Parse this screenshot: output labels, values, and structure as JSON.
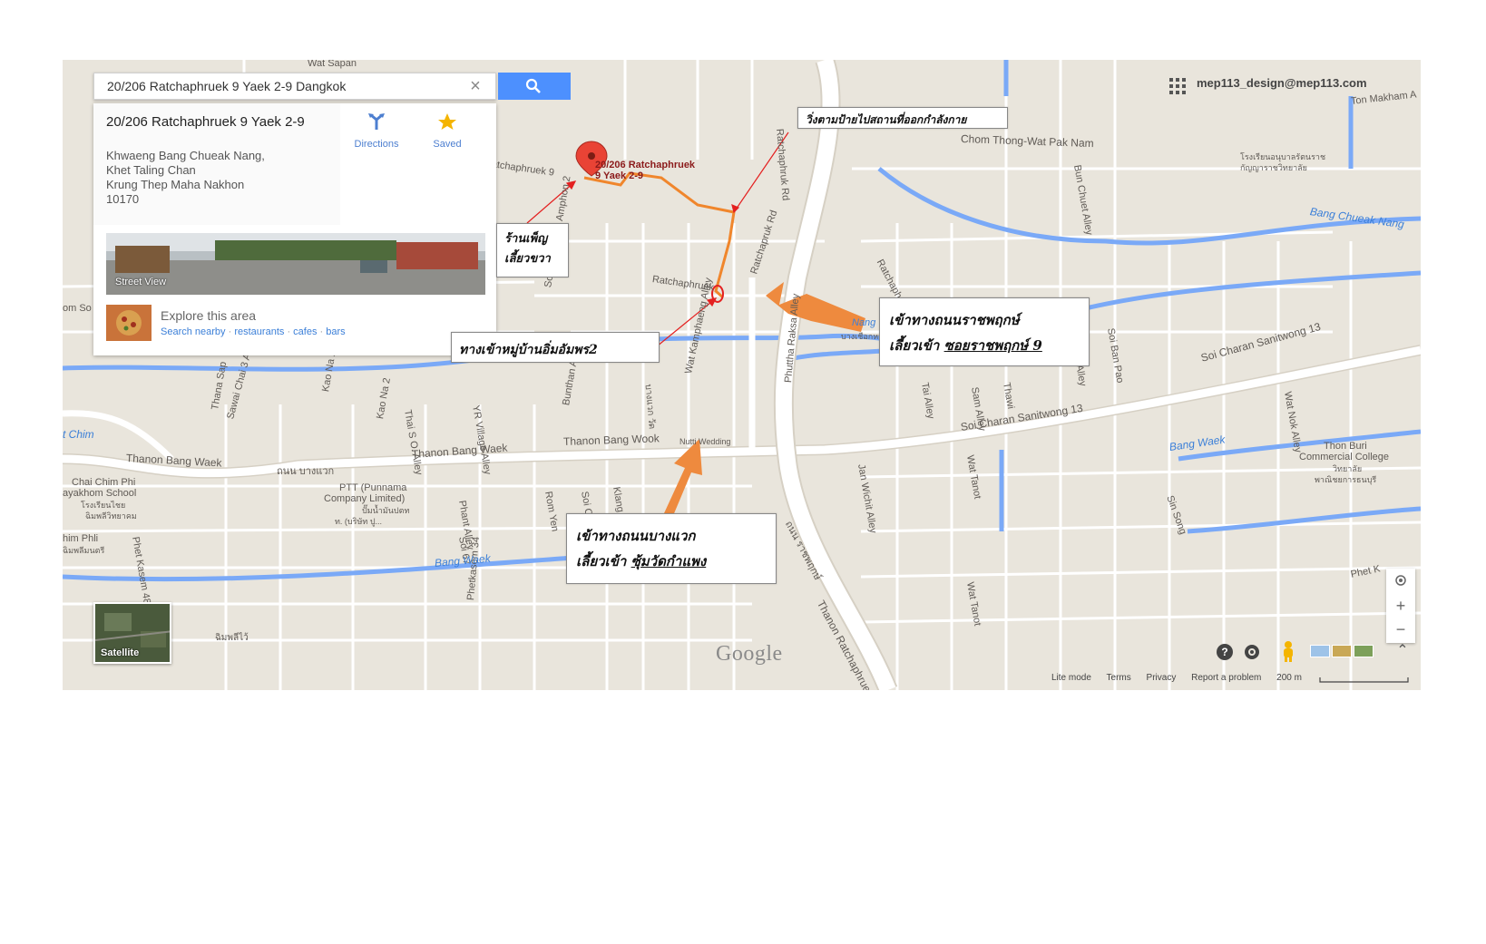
{
  "search": {
    "query": "20/206 Ratchaphruek 9 Yaek 2-9 Dangkok"
  },
  "place_card": {
    "title": "20/206 Ratchaphruek 9 Yaek 2-9",
    "address_lines": [
      "Khwaeng Bang Chueak Nang,",
      "Khet Taling Chan",
      "Krung Thep Maha Nakhon",
      "10170"
    ],
    "directions_label": "Directions",
    "saved_label": "Saved",
    "street_view_label": "Street View",
    "explore_title": "Explore this area",
    "explore_links": [
      "Search nearby",
      "restaurants",
      "cafes",
      "bars"
    ],
    "explore_sep": "·"
  },
  "account": {
    "email": "mep113_design@mep113.com"
  },
  "marker_label": [
    "20/206 Ratchaphruek",
    "9 Yaek 2-9"
  ],
  "callouts": {
    "top_right": "วิ่งตามป้ายไปสถานที่ออกกำลังกาย",
    "shop_line1": "ร้านเพ็ญ",
    "shop_line2": "เลี้ยวขวา",
    "village_entrance": "ทางเข้าหมู่บ้านอิ่มอัมพร2",
    "ratchaphruek_line1": "เข้าทางถนนราชพฤกษ์",
    "ratchaphruek_line2_prefix": "เลี้ยวเข้า",
    "ratchaphruek_line2_link": "ซอยราชพฤกษ์ 9",
    "bangwaek_line1": "เข้าทางถนนบางแวก",
    "bangwaek_line2_prefix": "เลี้ยวเข้า",
    "bangwaek_line2_link": "ซุ้มวัดกำแพง"
  },
  "map_labels": {
    "wat_sapan": "Wat Sapan",
    "ratchaphruek_9": "Ratchaphruek 9",
    "ratchaphruek_mid": "Ratchaphruek",
    "ratchaphruk_rd": "Ratchapruk Rd",
    "ratchaphruk_rd_top": "Ratchaphruk Rd",
    "chom_thong": "Chom Thong-Wat Pak Nam",
    "ton_makham": "Ton Makham A",
    "bang_chueak_nang": "Bang Chueak Nang",
    "bun_chuet": "Bun Chuet Alley",
    "rr_school": "โรงเรียนอนุบาลรัตนราช",
    "rr_school2": "กัญญาราชวิทยาลัย",
    "ratchaphruek_2yaek9": "Ratchaphruek 2 Yaek 9",
    "soi_charan_13_top": "Soi Charan Sanitwong 13",
    "soi_charan_13": "Soi Charan Sanitwong 13",
    "soi_mu_ban": "Soi Mu Ban Im Amphon 2",
    "nang": "Nang",
    "bang_sue_thai": "บางเชือกหนัง",
    "phuttha_raksa": "Phuttha Raksa Alley",
    "tai_alley": "Tai Alley",
    "sam_alley": "Sam Alley",
    "thawi": "Thawi",
    "ban_pao": "Soi Ban Pao",
    "wang_alley": "Wang Alley",
    "wat_nok": "Wat Nok Alley",
    "chim_left": "t Chim",
    "om_so": "om So",
    "thanon_bang_waek_left": "Thanon Bang Waek",
    "thai_bang_waek": "ถนน บางแวก",
    "thanon_bang_waek_mid": "Thanon Bang Waek",
    "thanon_bang_wook": "Thanon Bang Wook",
    "nutti_wedding": "Nutti Wedding",
    "bang_waek_right": "Bang Waek",
    "thon_buri_college": "Thon Buri",
    "thon_buri_college2": "Commercial College",
    "thon_buri_thai": "วิทยาลัย",
    "thon_buri_thai2": "พาณิชยการธนบุรี",
    "chai_chim": "Chai Chim Phi",
    "chai_chim2": "ayakhom School",
    "chai_chim_thai": "โรงเรียนไชย",
    "chai_chim_thai2": "ฉิมพลีวิทยาคม",
    "ptt": "PTT (Punnama",
    "ptt2": "Company Limited)",
    "ptt_thai": "ปั๊มน้ำมันปตท",
    "ptt_thai2": "ท. (บริษัท ปู...",
    "thana_sap": "Thana Sap",
    "sawai_chai": "Sawai Chai 3 Alley",
    "kao_na_2": "Kao Na 2",
    "kao_na_2b": "Kao Na 2",
    "thai_so": "Thai S O. Alley",
    "yr_village": "YR Village Alley",
    "bunthan": "Bunthan Alley",
    "wat_kamphaeng": "Wat Kamphaeng Alley",
    "phant_alley": "Phant Alley",
    "rom_yen": "Rom Yen",
    "soi_chaiya": "Soi Chaiya Phe",
    "klang_suan": "Klang Suan",
    "soi_67": "Soi 67",
    "phet_kasem_48": "Phet Kasem 48",
    "phetkasem_34": "Phetkasem 34",
    "bang_waek_canal": "Bang Waek",
    "him_phli": "him Phli",
    "him_phli_thai": "ฉิมพลีมนตรี",
    "thai_chim_bottom": "ฉิมพลีไว้",
    "tha_ratchaphruek": "Thanon Ratchaphruek",
    "thai_ratchaphruek": "ถนน ราชพฤกษ์",
    "wat_tanot": "Wat Tanot",
    "wat_tanot2": "Wat Tanot",
    "jan_wichit": "Jan Wichit Alley",
    "sin_song": "Sin Song",
    "phet_k": "Phet K",
    "thai_bang_waek_vert": "บางแวก วัด"
  },
  "controls": {
    "satellite_label": "Satellite",
    "zoom_in": "+",
    "zoom_out": "−",
    "logo": "Google",
    "expand_glyph": "⌃",
    "clear_glyph": "×"
  },
  "footer": {
    "lite_mode": "Lite mode",
    "terms": "Terms",
    "privacy": "Privacy",
    "report": "Report a problem",
    "scale": "200 m"
  },
  "colors": {
    "land": "#e9e5dc",
    "road": "#ffffff",
    "water": "#7aa9f7",
    "route": "#f0862c",
    "arrow": "#ee8a3e",
    "search_button": "#4d90fe",
    "pin": "#e94335"
  }
}
